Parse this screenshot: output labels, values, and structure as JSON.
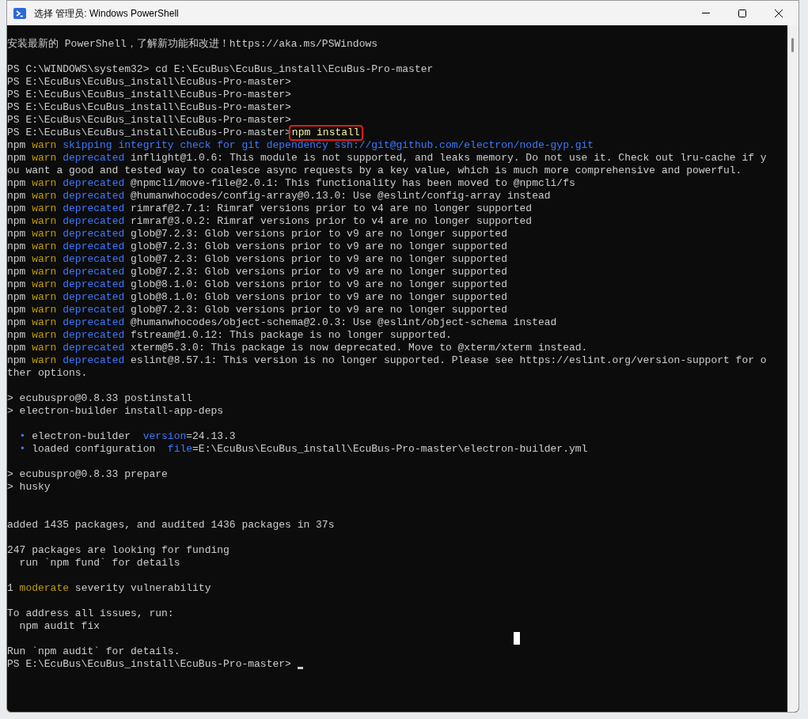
{
  "window": {
    "title": "选择 管理员: Windows PowerShell"
  },
  "terminal": {
    "lines": [
      {
        "kind": "text",
        "segments": [
          {
            "kind": "plain",
            "text": "安装最新的 PowerShell，了解新功能和改进！https://aka.ms/PSWindows"
          }
        ]
      },
      {
        "kind": "blank"
      },
      {
        "kind": "text",
        "segments": [
          {
            "kind": "plain",
            "text": "PS C:\\WINDOWS\\system32> cd E:\\EcuBus\\EcuBus_install\\EcuBus-Pro-master"
          }
        ]
      },
      {
        "kind": "text",
        "segments": [
          {
            "kind": "plain",
            "text": "PS E:\\EcuBus\\EcuBus_install\\EcuBus-Pro-master>"
          }
        ]
      },
      {
        "kind": "text",
        "segments": [
          {
            "kind": "plain",
            "text": "PS E:\\EcuBus\\EcuBus_install\\EcuBus-Pro-master>"
          }
        ]
      },
      {
        "kind": "text",
        "segments": [
          {
            "kind": "plain",
            "text": "PS E:\\EcuBus\\EcuBus_install\\EcuBus-Pro-master>"
          }
        ]
      },
      {
        "kind": "text",
        "segments": [
          {
            "kind": "plain",
            "text": "PS E:\\EcuBus\\EcuBus_install\\EcuBus-Pro-master>"
          }
        ]
      },
      {
        "kind": "text",
        "segments": [
          {
            "kind": "plain",
            "text": "PS E:\\EcuBus\\EcuBus_install\\EcuBus-Pro-master>"
          },
          {
            "kind": "command",
            "text": "npm install",
            "boxed": true
          }
        ]
      },
      {
        "kind": "text",
        "segments": [
          {
            "kind": "plain",
            "text": "npm "
          },
          {
            "kind": "warn",
            "text": "warn"
          },
          {
            "kind": "info",
            "text": " skipping integrity check for git dependency ssh://git@github.com/electron/node-gyp.git"
          }
        ]
      },
      {
        "kind": "text",
        "segments": [
          {
            "kind": "plain",
            "text": "npm "
          },
          {
            "kind": "warn",
            "text": "warn"
          },
          {
            "kind": "info",
            "text": " deprecated"
          },
          {
            "kind": "plain",
            "text": " inflight@1.0.6: This module is not supported, and leaks memory. Do not use it. Check out lru-cache if y"
          }
        ]
      },
      {
        "kind": "text",
        "segments": [
          {
            "kind": "plain",
            "text": "ou want a good and tested way to coalesce async requests by a key value, which is much more comprehensive and powerful."
          }
        ]
      },
      {
        "kind": "text",
        "segments": [
          {
            "kind": "plain",
            "text": "npm "
          },
          {
            "kind": "warn",
            "text": "warn"
          },
          {
            "kind": "info",
            "text": " deprecated"
          },
          {
            "kind": "plain",
            "text": " @npmcli/move-file@2.0.1: This functionality has been moved to @npmcli/fs"
          }
        ]
      },
      {
        "kind": "text",
        "segments": [
          {
            "kind": "plain",
            "text": "npm "
          },
          {
            "kind": "warn",
            "text": "warn"
          },
          {
            "kind": "info",
            "text": " deprecated"
          },
          {
            "kind": "plain",
            "text": " @humanwhocodes/config-array@0.13.0: Use @eslint/config-array instead"
          }
        ]
      },
      {
        "kind": "text",
        "segments": [
          {
            "kind": "plain",
            "text": "npm "
          },
          {
            "kind": "warn",
            "text": "warn"
          },
          {
            "kind": "info",
            "text": " deprecated"
          },
          {
            "kind": "plain",
            "text": " rimraf@2.7.1: Rimraf versions prior to v4 are no longer supported"
          }
        ]
      },
      {
        "kind": "text",
        "segments": [
          {
            "kind": "plain",
            "text": "npm "
          },
          {
            "kind": "warn",
            "text": "warn"
          },
          {
            "kind": "info",
            "text": " deprecated"
          },
          {
            "kind": "plain",
            "text": " rimraf@3.0.2: Rimraf versions prior to v4 are no longer supported"
          }
        ]
      },
      {
        "kind": "text",
        "segments": [
          {
            "kind": "plain",
            "text": "npm "
          },
          {
            "kind": "warn",
            "text": "warn"
          },
          {
            "kind": "info",
            "text": " deprecated"
          },
          {
            "kind": "plain",
            "text": " glob@7.2.3: Glob versions prior to v9 are no longer supported"
          }
        ]
      },
      {
        "kind": "text",
        "segments": [
          {
            "kind": "plain",
            "text": "npm "
          },
          {
            "kind": "warn",
            "text": "warn"
          },
          {
            "kind": "info",
            "text": " deprecated"
          },
          {
            "kind": "plain",
            "text": " glob@7.2.3: Glob versions prior to v9 are no longer supported"
          }
        ]
      },
      {
        "kind": "text",
        "segments": [
          {
            "kind": "plain",
            "text": "npm "
          },
          {
            "kind": "warn",
            "text": "warn"
          },
          {
            "kind": "info",
            "text": " deprecated"
          },
          {
            "kind": "plain",
            "text": " glob@7.2.3: Glob versions prior to v9 are no longer supported"
          }
        ]
      },
      {
        "kind": "text",
        "segments": [
          {
            "kind": "plain",
            "text": "npm "
          },
          {
            "kind": "warn",
            "text": "warn"
          },
          {
            "kind": "info",
            "text": " deprecated"
          },
          {
            "kind": "plain",
            "text": " glob@7.2.3: Glob versions prior to v9 are no longer supported"
          }
        ]
      },
      {
        "kind": "text",
        "segments": [
          {
            "kind": "plain",
            "text": "npm "
          },
          {
            "kind": "warn",
            "text": "warn"
          },
          {
            "kind": "info",
            "text": " deprecated"
          },
          {
            "kind": "plain",
            "text": " glob@8.1.0: Glob versions prior to v9 are no longer supported"
          }
        ]
      },
      {
        "kind": "text",
        "segments": [
          {
            "kind": "plain",
            "text": "npm "
          },
          {
            "kind": "warn",
            "text": "warn"
          },
          {
            "kind": "info",
            "text": " deprecated"
          },
          {
            "kind": "plain",
            "text": " glob@8.1.0: Glob versions prior to v9 are no longer supported"
          }
        ]
      },
      {
        "kind": "text",
        "segments": [
          {
            "kind": "plain",
            "text": "npm "
          },
          {
            "kind": "warn",
            "text": "warn"
          },
          {
            "kind": "info",
            "text": " deprecated"
          },
          {
            "kind": "plain",
            "text": " glob@7.2.3: Glob versions prior to v9 are no longer supported"
          }
        ]
      },
      {
        "kind": "text",
        "segments": [
          {
            "kind": "plain",
            "text": "npm "
          },
          {
            "kind": "warn",
            "text": "warn"
          },
          {
            "kind": "info",
            "text": " deprecated"
          },
          {
            "kind": "plain",
            "text": " @humanwhocodes/object-schema@2.0.3: Use @eslint/object-schema instead"
          }
        ]
      },
      {
        "kind": "text",
        "segments": [
          {
            "kind": "plain",
            "text": "npm "
          },
          {
            "kind": "warn",
            "text": "warn"
          },
          {
            "kind": "info",
            "text": " deprecated"
          },
          {
            "kind": "plain",
            "text": " fstream@1.0.12: This package is no longer supported."
          }
        ]
      },
      {
        "kind": "text",
        "segments": [
          {
            "kind": "plain",
            "text": "npm "
          },
          {
            "kind": "warn",
            "text": "warn"
          },
          {
            "kind": "info",
            "text": " deprecated"
          },
          {
            "kind": "plain",
            "text": " xterm@5.3.0: This package is now deprecated. Move to @xterm/xterm instead."
          }
        ]
      },
      {
        "kind": "text",
        "segments": [
          {
            "kind": "plain",
            "text": "npm "
          },
          {
            "kind": "warn",
            "text": "warn"
          },
          {
            "kind": "info",
            "text": " deprecated"
          },
          {
            "kind": "plain",
            "text": " eslint@8.57.1: This version is no longer supported. Please see https://eslint.org/version-support for o"
          }
        ]
      },
      {
        "kind": "text",
        "segments": [
          {
            "kind": "plain",
            "text": "ther options."
          }
        ]
      },
      {
        "kind": "blank"
      },
      {
        "kind": "text",
        "segments": [
          {
            "kind": "plain",
            "text": "> ecubuspro@0.8.33 postinstall"
          }
        ]
      },
      {
        "kind": "text",
        "segments": [
          {
            "kind": "plain",
            "text": "> electron-builder install-app-deps"
          }
        ]
      },
      {
        "kind": "blank"
      },
      {
        "kind": "text",
        "segments": [
          {
            "kind": "info",
            "text": "  •"
          },
          {
            "kind": "plain",
            "text": " electron-builder  "
          },
          {
            "kind": "info",
            "text": "version"
          },
          {
            "kind": "plain",
            "text": "=24.13.3"
          }
        ]
      },
      {
        "kind": "text",
        "segments": [
          {
            "kind": "info",
            "text": "  •"
          },
          {
            "kind": "plain",
            "text": " loaded configuration  "
          },
          {
            "kind": "info",
            "text": "file"
          },
          {
            "kind": "plain",
            "text": "=E:\\EcuBus\\EcuBus_install\\EcuBus-Pro-master\\electron-builder.yml"
          }
        ]
      },
      {
        "kind": "blank"
      },
      {
        "kind": "text",
        "segments": [
          {
            "kind": "plain",
            "text": "> ecubuspro@0.8.33 prepare"
          }
        ]
      },
      {
        "kind": "text",
        "segments": [
          {
            "kind": "plain",
            "text": "> husky"
          }
        ]
      },
      {
        "kind": "blank"
      },
      {
        "kind": "blank"
      },
      {
        "kind": "text",
        "segments": [
          {
            "kind": "plain",
            "text": "added 1435 packages, and audited 1436 packages in 37s"
          }
        ]
      },
      {
        "kind": "blank"
      },
      {
        "kind": "text",
        "segments": [
          {
            "kind": "plain",
            "text": "247 packages are looking for funding"
          }
        ]
      },
      {
        "kind": "text",
        "segments": [
          {
            "kind": "plain",
            "text": "  run `npm fund` for details"
          }
        ]
      },
      {
        "kind": "blank"
      },
      {
        "kind": "text",
        "segments": [
          {
            "kind": "plain",
            "text": "1 "
          },
          {
            "kind": "warn",
            "text": "moderate"
          },
          {
            "kind": "plain",
            "text": " severity vulnerability"
          }
        ]
      },
      {
        "kind": "blank"
      },
      {
        "kind": "text",
        "segments": [
          {
            "kind": "plain",
            "text": "To address all issues, run:"
          }
        ]
      },
      {
        "kind": "text",
        "segments": [
          {
            "kind": "plain",
            "text": "  npm audit fix"
          }
        ]
      },
      {
        "kind": "blank"
      },
      {
        "kind": "text",
        "segments": [
          {
            "kind": "plain",
            "text": "Run `npm audit` for details."
          }
        ]
      },
      {
        "kind": "prompt",
        "segments": [
          {
            "kind": "plain",
            "text": "PS E:\\EcuBus\\EcuBus_install\\EcuBus-Pro-master> "
          }
        ]
      }
    ]
  }
}
